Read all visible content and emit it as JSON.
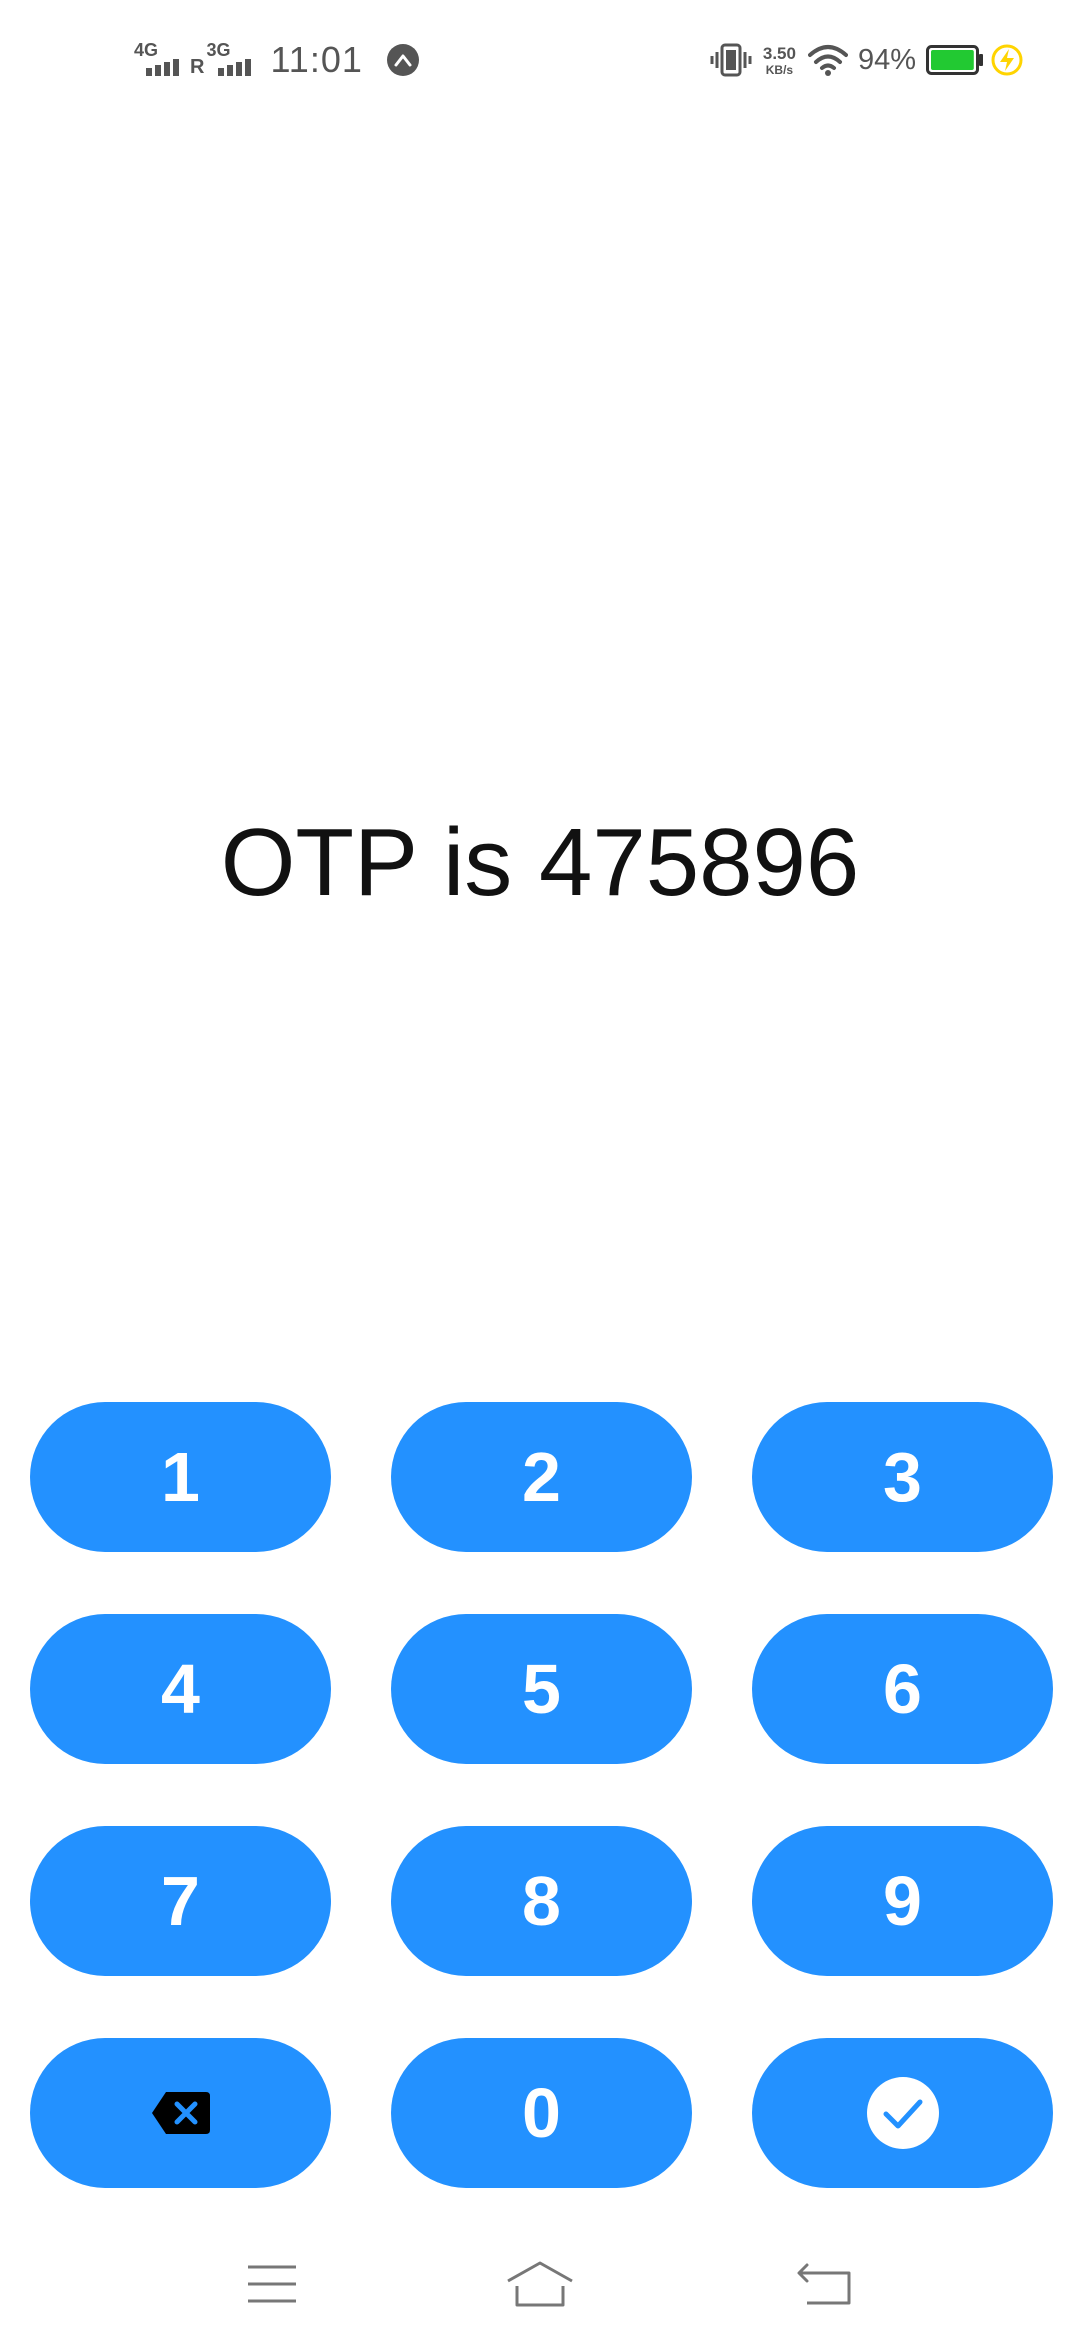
{
  "status_bar": {
    "sim1_network": "4G",
    "roaming": "R",
    "sim2_network": "3G",
    "time": "11:01",
    "notification_icon": "arrow-up-circle-icon",
    "speed_value": "3.50",
    "speed_unit": "KB/s",
    "battery_percent": "94%",
    "battery_level": 0.94,
    "battery_color": "#22C932",
    "charging_color": "#FFD400"
  },
  "message": {
    "text": "OTP is 475896"
  },
  "keypad": {
    "key_color": "#2391FF",
    "keys": [
      "1",
      "2",
      "3",
      "4",
      "5",
      "6",
      "7",
      "8",
      "9",
      "0"
    ],
    "backspace_icon": "backspace-icon",
    "confirm_icon": "check-circle-icon"
  },
  "nav_bar": {
    "menu_icon": "menu-icon",
    "home_icon": "home-icon",
    "back_icon": "back-icon"
  }
}
